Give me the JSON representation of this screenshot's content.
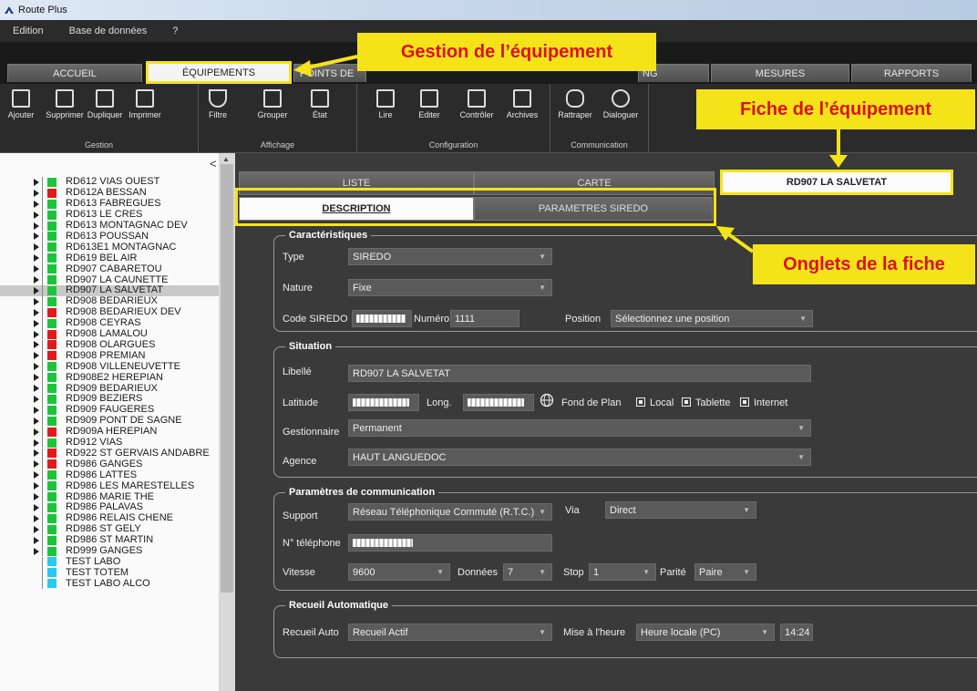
{
  "window": {
    "title": "Route Plus"
  },
  "menu": [
    "Edition",
    "Base de données",
    "?"
  ],
  "main_tabs": [
    {
      "label": "ACCUEIL"
    },
    {
      "label": "ÉQUIPEMENTS"
    },
    {
      "label": "POINTS DE"
    },
    {
      "label": "NG"
    },
    {
      "label": "MESURES"
    },
    {
      "label": "RAPPORTS"
    }
  ],
  "ribbon": {
    "gestion": {
      "caption": "Gestion",
      "buttons": [
        "Ajouter",
        "Supprimer",
        "Dupliquer",
        "Imprimer"
      ]
    },
    "affichage": {
      "caption": "Affichage",
      "buttons": [
        "Filtre",
        "Grouper",
        "État"
      ]
    },
    "configuration": {
      "caption": "Configuration",
      "buttons": [
        "Lire",
        "Editer",
        "Contrôler",
        "Archives"
      ]
    },
    "communication": {
      "caption": "Communication",
      "buttons": [
        "Rattraper",
        "Dialoguer"
      ]
    }
  },
  "tree": {
    "items": [
      {
        "label": "RD612 VIAS OUEST",
        "status": "green"
      },
      {
        "label": "RD612A BESSAN",
        "status": "red"
      },
      {
        "label": "RD613 FABREGUES",
        "status": "green"
      },
      {
        "label": "RD613 LE CRES",
        "status": "green"
      },
      {
        "label": "RD613 MONTAGNAC DEV",
        "status": "green"
      },
      {
        "label": "RD613 POUSSAN",
        "status": "green"
      },
      {
        "label": "RD613E1 MONTAGNAC",
        "status": "green"
      },
      {
        "label": "RD619 BEL AIR",
        "status": "green"
      },
      {
        "label": "RD907 CABARETOU",
        "status": "green"
      },
      {
        "label": "RD907 LA CAUNETTE",
        "status": "green"
      },
      {
        "label": "RD907 LA SALVETAT",
        "status": "green"
      },
      {
        "label": "RD908 BEDARIEUX",
        "status": "green"
      },
      {
        "label": "RD908 BEDARIEUX DEV",
        "status": "red"
      },
      {
        "label": "RD908 CEYRAS",
        "status": "green"
      },
      {
        "label": "RD908 LAMALOU",
        "status": "red"
      },
      {
        "label": "RD908 OLARGUES",
        "status": "red"
      },
      {
        "label": "RD908 PREMIAN",
        "status": "red"
      },
      {
        "label": "RD908 VILLENEUVETTE",
        "status": "green"
      },
      {
        "label": "RD908E2 HEREPIAN",
        "status": "green"
      },
      {
        "label": "RD909 BEDARIEUX",
        "status": "green"
      },
      {
        "label": "RD909 BEZIERS",
        "status": "green"
      },
      {
        "label": "RD909 FAUGERES",
        "status": "green"
      },
      {
        "label": "RD909 PONT DE SAGNE",
        "status": "green"
      },
      {
        "label": "RD909A HEREPIAN",
        "status": "red"
      },
      {
        "label": "RD912 VIAS",
        "status": "green"
      },
      {
        "label": "RD922 ST GERVAIS ANDABRE",
        "status": "red"
      },
      {
        "label": "RD986 GANGES",
        "status": "red"
      },
      {
        "label": "RD986 LATTES",
        "status": "green"
      },
      {
        "label": "RD986 LES MARESTELLES",
        "status": "green"
      },
      {
        "label": "RD986 MARIE THE",
        "status": "green"
      },
      {
        "label": "RD986 PALAVAS",
        "status": "green"
      },
      {
        "label": "RD986 RELAIS CHENE",
        "status": "green"
      },
      {
        "label": "RD986 ST GELY",
        "status": "green"
      },
      {
        "label": "RD986 ST MARTIN",
        "status": "green"
      },
      {
        "label": "RD999 GANGES",
        "status": "green"
      },
      {
        "label": "TEST LABO",
        "status": "cyan"
      },
      {
        "label": "TEST TOTEM",
        "status": "cyan"
      },
      {
        "label": "TEST LABO ALCO",
        "status": "cyan"
      }
    ]
  },
  "view_tabs": {
    "liste": "LISTE",
    "carte": "CARTE",
    "fiche": "RD907 LA SALVETAT"
  },
  "fiche_tabs": {
    "description": "DESCRIPTION",
    "parametres": "PARAMETRES SIREDO"
  },
  "caracteristiques": {
    "legend": "Caractéristiques",
    "type_label": "Type",
    "type_value": "SIREDO",
    "nature_label": "Nature",
    "nature_value": "Fixe",
    "code_label": "Code SIREDO",
    "numero_label": "Numéro",
    "numero_value": "1111",
    "position_label": "Position",
    "position_value": "Sélectionnez une position"
  },
  "situation": {
    "legend": "Situation",
    "libelle_label": "Libellé",
    "libelle_value": "RD907 LA SALVETAT",
    "latitude_label": "Latitude",
    "long_label": "Long.",
    "fond_label": "Fond de Plan",
    "local_label": "Local",
    "tablette_label": "Tablette",
    "internet_label": "Internet",
    "gestionnaire_label": "Gestionnaire",
    "gestionnaire_value": "Permanent",
    "agence_label": "Agence",
    "agence_value": "HAUT LANGUEDOC"
  },
  "communication": {
    "legend": "Paramètres de communication",
    "support_label": "Support",
    "support_value": "Réseau Téléphonique Commuté (R.T.C.)",
    "via_label": "Via",
    "via_value": "Direct",
    "tel_label": "N° téléphone",
    "vitesse_label": "Vitesse",
    "vitesse_value": "9600",
    "donnees_label": "Données",
    "donnees_value": "7",
    "stop_label": "Stop",
    "stop_value": "1",
    "parite_label": "Parité",
    "parite_value": "Paire"
  },
  "recueil": {
    "legend": "Recueil Automatique",
    "auto_label": "Recueil Auto",
    "auto_value": "Recueil Actif",
    "mise_label": "Mise à l'heure",
    "mise_value": "Heure locale (PC)",
    "time_value": "14:24"
  },
  "callouts": {
    "gestion": "Gestion de l’équipement",
    "fiche": "Fiche de l’équipement",
    "onglets": "Onglets de la fiche"
  },
  "colors": {
    "highlight": "#f5e31a",
    "callout_text": "#dd1111",
    "status_green": "#1dc43b",
    "status_red": "#e01b1b",
    "status_cyan": "#29c9f0"
  }
}
